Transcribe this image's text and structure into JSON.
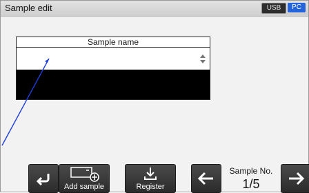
{
  "header": {
    "title": "Sample edit",
    "usb_badge": "USB",
    "pc_badge": "PC"
  },
  "table": {
    "header": "Sample name",
    "current_value": ""
  },
  "toolbar": {
    "add_sample_label": "Add sample",
    "register_label": "Register",
    "sample_no_title": "Sample No.",
    "sample_no_value": "1/5"
  },
  "colors": {
    "accent_blue": "#2563d9",
    "toolbar_dark": "#2b2b2b"
  },
  "icons": {
    "back": "back-arrow-icon",
    "add_sample": "add-sample-icon",
    "register": "download-icon",
    "prev": "left-arrow-icon",
    "next": "right-arrow-icon",
    "usb": "usb-icon",
    "pc": "pc-connection-icon",
    "bluetooth": "bluetooth-icon",
    "spin": "spinner-icon"
  }
}
